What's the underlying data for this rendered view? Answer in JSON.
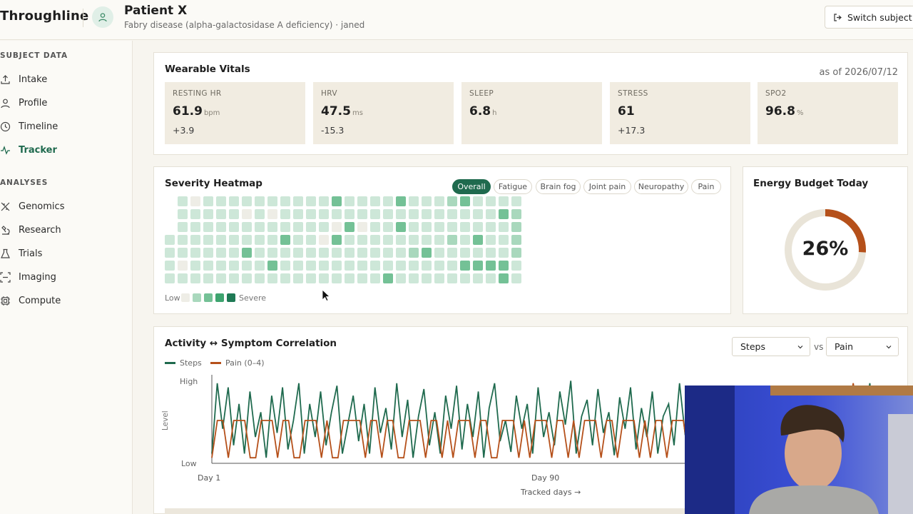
{
  "app": {
    "brand": "Throughline"
  },
  "patient": {
    "name": "Patient X",
    "subtitle": "Fabry disease (alpha-galactosidase A deficiency) · janed"
  },
  "header": {
    "switch_label": "Switch subject"
  },
  "sidebar": {
    "sections": [
      {
        "label": "SUBJECT DATA",
        "items": [
          {
            "label": "Intake",
            "icon": "upload-icon"
          },
          {
            "label": "Profile",
            "icon": "user-icon"
          },
          {
            "label": "Timeline",
            "icon": "clock-icon"
          },
          {
            "label": "Tracker",
            "icon": "activity-icon",
            "active": true
          }
        ]
      },
      {
        "label": "ANALYSES",
        "items": [
          {
            "label": "Genomics",
            "icon": "dna-icon"
          },
          {
            "label": "Research",
            "icon": "microscope-icon"
          },
          {
            "label": "Trials",
            "icon": "flask-icon"
          },
          {
            "label": "Imaging",
            "icon": "scan-icon"
          },
          {
            "label": "Compute",
            "icon": "cpu-icon"
          }
        ]
      }
    ]
  },
  "vitals": {
    "title": "Wearable Vitals",
    "as_of": "as of 2026/07/12",
    "tiles": [
      {
        "label": "RESTING HR",
        "value": "61.9",
        "unit": "bpm",
        "delta": "+3.9"
      },
      {
        "label": "HRV",
        "value": "47.5",
        "unit": "ms",
        "delta": "-15.3"
      },
      {
        "label": "SLEEP",
        "value": "6.8",
        "unit": "h",
        "delta": ""
      },
      {
        "label": "STRESS",
        "value": "61",
        "unit": "",
        "delta": "+17.3"
      },
      {
        "label": "SPO2",
        "value": "96.8",
        "unit": "%",
        "delta": ""
      }
    ]
  },
  "heatmap": {
    "title": "Severity Heatmap",
    "filters": [
      "Overall",
      "Fatigue",
      "Brain fog",
      "Joint pain",
      "Neuropathy",
      "Pain"
    ],
    "active_filter": "Overall",
    "legend_low": "Low",
    "legend_high": "Severe",
    "palette": [
      "#eeede6",
      "#cde7d8",
      "#a9d8bd",
      "#74c196",
      "#3ea46f",
      "#1f7a55"
    ],
    "cells": [
      [
        null,
        1,
        0,
        1,
        1,
        1,
        1,
        1,
        1,
        1,
        1,
        1,
        1,
        3,
        1,
        1,
        1,
        1,
        3,
        1,
        1,
        1,
        2,
        3,
        1,
        1,
        1,
        1
      ],
      [
        null,
        1,
        1,
        1,
        1,
        1,
        0,
        1,
        0,
        1,
        1,
        1,
        1,
        1,
        1,
        1,
        1,
        1,
        1,
        1,
        1,
        1,
        1,
        1,
        1,
        1,
        3,
        2
      ],
      [
        null,
        1,
        1,
        1,
        1,
        1,
        1,
        1,
        1,
        1,
        1,
        1,
        1,
        0,
        3,
        0,
        1,
        1,
        3,
        1,
        1,
        1,
        1,
        1,
        1,
        1,
        1,
        2
      ],
      [
        1,
        1,
        1,
        1,
        1,
        1,
        1,
        1,
        1,
        3,
        1,
        1,
        0,
        3,
        1,
        1,
        1,
        1,
        1,
        1,
        1,
        1,
        2,
        1,
        3,
        1,
        1,
        2
      ],
      [
        1,
        1,
        1,
        1,
        1,
        1,
        3,
        1,
        1,
        1,
        1,
        1,
        1,
        1,
        1,
        1,
        1,
        1,
        1,
        2,
        3,
        1,
        1,
        1,
        1,
        1,
        1,
        2
      ],
      [
        1,
        0,
        1,
        1,
        1,
        1,
        1,
        1,
        3,
        1,
        1,
        1,
        1,
        1,
        1,
        1,
        1,
        1,
        1,
        1,
        1,
        1,
        1,
        3,
        3,
        3,
        3,
        1
      ],
      [
        1,
        1,
        1,
        1,
        1,
        1,
        1,
        1,
        1,
        1,
        1,
        1,
        1,
        1,
        1,
        1,
        1,
        3,
        1,
        1,
        1,
        1,
        1,
        1,
        1,
        1,
        3,
        1
      ]
    ]
  },
  "energy": {
    "title": "Energy Budget Today",
    "percent": 26,
    "percent_label": "26%",
    "ring_color": "#b5501a",
    "track_color": "#e9e4d8"
  },
  "correlation": {
    "title": "Activity ↔ Symptom Correlation",
    "select_a": "Steps",
    "vs": "vs",
    "select_b": "Pain",
    "chart_data": {
      "type": "line",
      "title": "",
      "xlabel": "Tracked days →",
      "ylabel": "Level",
      "y_tick_labels": [
        "Low",
        "High"
      ],
      "x_tick_labels": [
        {
          "day": 1,
          "label": "Day 1"
        },
        {
          "day": 90,
          "label": "Day 90"
        }
      ],
      "legend": "top-left",
      "series": [
        {
          "name": "Steps",
          "color": "#1f6a4e",
          "values": [
            0.1,
            0.95,
            0.4,
            0.9,
            0.2,
            0.7,
            0.1,
            0.85,
            0.3,
            0.6,
            0.05,
            0.8,
            0.35,
            0.9,
            0.15,
            0.5,
            0.95,
            0.1,
            0.7,
            0.3,
            0.85,
            0.2,
            0.6,
            0.92,
            0.1,
            0.45,
            0.8,
            0.25,
            0.7,
            0.1,
            0.9,
            0.35,
            0.65,
            0.15,
            0.95,
            0.3,
            0.75,
            0.05,
            0.55,
            0.88,
            0.2,
            0.6,
            0.1,
            0.8,
            0.4,
            0.92,
            0.15,
            0.7,
            0.3,
            0.85,
            0.05,
            0.65,
            0.95,
            0.25,
            0.5,
            0.12,
            0.8,
            0.4,
            0.7,
            0.1,
            0.9,
            0.3,
            0.6,
            0.2,
            0.85,
            0.45,
            0.98,
            0.1,
            0.55,
            0.75,
            0.2,
            0.88,
            0.35,
            0.6,
            0.08,
            0.78,
            0.4,
            0.9,
            0.15,
            0.65,
            0.3,
            0.85,
            0.1,
            0.55,
            0.7,
            0.2,
            0.95,
            0.35,
            0.5,
            0.1,
            0.8,
            0.45,
            0.7,
            0.2,
            0.6,
            0.05,
            0.9,
            0.3,
            0.75,
            0.15,
            0.85,
            0.4,
            0.55,
            0.1,
            0.7,
            0.25,
            0.92,
            0.35,
            0.6,
            0.1,
            0.8,
            0.2,
            0.65,
            0.45,
            0.9,
            0.1,
            0.7,
            0.3,
            0.85,
            0.15,
            0.55,
            0.95,
            0.2,
            0.6,
            0.35,
            0.8
          ]
        },
        {
          "name": "Pain (0–4)",
          "color": "#b5501a",
          "values": [
            0.05,
            0.5,
            0.5,
            0.05,
            0.5,
            0.5,
            0.5,
            0.05,
            0.05,
            0.5,
            0.5,
            0.5,
            0.05,
            0.5,
            0.5,
            0.05,
            0.05,
            0.5,
            0.5,
            0.5,
            0.05,
            0.5,
            0.05,
            0.05,
            0.5,
            0.5,
            0.5,
            0.5,
            0.05,
            0.5,
            0.5,
            0.05,
            0.5,
            0.5,
            0.05,
            0.05,
            0.5,
            0.5,
            0.5,
            0.05,
            0.5,
            0.5,
            0.05,
            0.5,
            0.05,
            0.5,
            0.5,
            0.5,
            0.05,
            0.5,
            0.5,
            0.05,
            0.05,
            0.5,
            0.5,
            0.5,
            0.05,
            0.5,
            0.05,
            0.5,
            0.5,
            0.5,
            0.05,
            0.5,
            0.5,
            0.05,
            0.5,
            0.05,
            0.5,
            0.5,
            0.5,
            0.05,
            0.5,
            0.5,
            0.05,
            0.5,
            0.5,
            0.5,
            0.05,
            0.5,
            0.05,
            0.5,
            0.5,
            0.05,
            0.5,
            0.5,
            0.5,
            0.05,
            0.5,
            0.5,
            0.05,
            0.5,
            0.5,
            0.05,
            0.5,
            0.05,
            0.5,
            0.5,
            0.5,
            0.05,
            0.5,
            0.5,
            0.05,
            0.5,
            0.5,
            0.5,
            0.05,
            0.5,
            0.05,
            0.5,
            0.5,
            0.5,
            0.05,
            0.5,
            0.5,
            0.05,
            0.5,
            0.95,
            0.5,
            0.05,
            0.5,
            0.5,
            0.05,
            0.5,
            0.5
          ]
        }
      ]
    }
  }
}
